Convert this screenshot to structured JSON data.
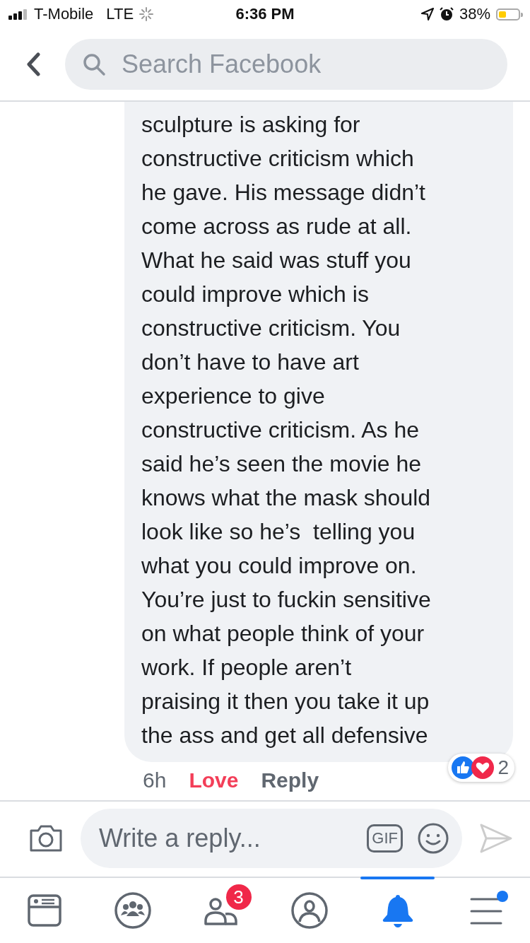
{
  "status_bar": {
    "carrier": "T-Mobile",
    "network": "LTE",
    "time": "6:36 PM",
    "battery_percent": "38%"
  },
  "search": {
    "placeholder": "Search Facebook"
  },
  "comment": {
    "lines": [
      "sculpture is asking for",
      "constructive criticism which",
      "he gave. His message didn’t",
      "come across as rude at all.",
      "What he said was stuff you",
      "could improve which is",
      "constructive criticism. You",
      "don’t have to have art",
      "experience to give",
      "constructive criticism. As he",
      "said he’s seen the movie he",
      "knows what the mask should",
      "look like so he’s  telling you",
      "what you could improve on.",
      "You’re just to fuckin sensitive",
      "on what people think of your",
      "work. If people aren’t",
      "praising it then you take it up",
      "the ass and get all defensive"
    ],
    "time": "6h",
    "love": {
      "label": "Love",
      "selected": true
    },
    "reply": "Reply",
    "reaction_count": "2"
  },
  "reply_box": {
    "placeholder": "Write a reply...",
    "gif": "GIF"
  },
  "tabs": [
    {
      "kind": "feed",
      "selected": false
    },
    {
      "kind": "groups",
      "selected": false
    },
    {
      "kind": "friends",
      "selected": false,
      "badge": "3"
    },
    {
      "kind": "profile",
      "selected": false
    },
    {
      "kind": "notifications",
      "selected": true
    },
    {
      "kind": "menu",
      "selected": false,
      "dot": true
    }
  ]
}
